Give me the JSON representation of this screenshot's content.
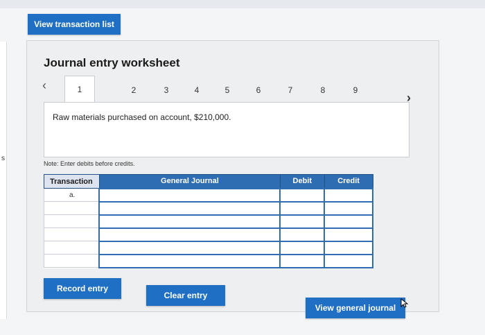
{
  "header": {
    "view_transactions_label": "View transaction list"
  },
  "worksheet": {
    "title": "Journal entry worksheet",
    "prev_icon": "chevron-left-icon",
    "next_icon": "chevron-right-icon",
    "tabs": [
      "1",
      "2",
      "3",
      "4",
      "5",
      "6",
      "7",
      "8",
      "9"
    ],
    "active_tab": "1",
    "entry_description": "Raw materials purchased on account, $210,000.",
    "note": "Note: Enter debits before credits."
  },
  "journal": {
    "columns": [
      "Transaction",
      "General Journal",
      "Debit",
      "Credit"
    ],
    "rows": [
      {
        "transaction": "a.",
        "account": "",
        "debit": "",
        "credit": ""
      },
      {
        "transaction": "",
        "account": "",
        "debit": "",
        "credit": ""
      },
      {
        "transaction": "",
        "account": "",
        "debit": "",
        "credit": ""
      },
      {
        "transaction": "",
        "account": "",
        "debit": "",
        "credit": ""
      },
      {
        "transaction": "",
        "account": "",
        "debit": "",
        "credit": ""
      },
      {
        "transaction": "",
        "account": "",
        "debit": "",
        "credit": ""
      }
    ]
  },
  "actions": {
    "record_label": "Record entry",
    "clear_label": "Clear entry",
    "view_journal_label": "View general journal"
  },
  "left_edge_mark": "s",
  "colors": {
    "accent": "#1f6fc5",
    "header_blue": "#2f6db2"
  }
}
